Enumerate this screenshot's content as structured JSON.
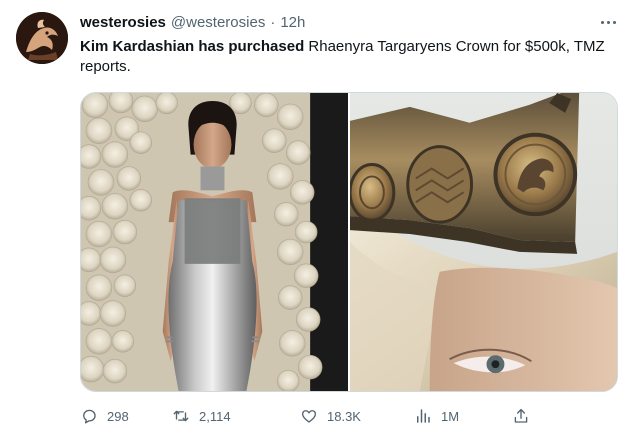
{
  "author": {
    "display_name": "westerosies",
    "handle": "@westerosies",
    "separator": "·",
    "time": "12h",
    "avatar_icon": "dragon-sigil-avatar"
  },
  "tweet": {
    "text_bold": "Kim Kardashian has purchased",
    "text_rest": " Rhaenyra Targaryens Crown for $500k, TMZ reports."
  },
  "media": {
    "left_photo": "woman-in-silver-dress-photo",
    "right_photo": "crown-closeup-photo"
  },
  "actions": {
    "reply_count": "298",
    "retweet_count": "2,114",
    "like_count": "18.3K",
    "view_count": "1M",
    "icons": [
      "reply-icon",
      "retweet-icon",
      "like-icon",
      "views-icon",
      "share-icon"
    ]
  },
  "colors": {
    "text": "#0f1419",
    "secondary": "#536471",
    "border": "#cfd9de",
    "accent": "#1d9bf0"
  }
}
